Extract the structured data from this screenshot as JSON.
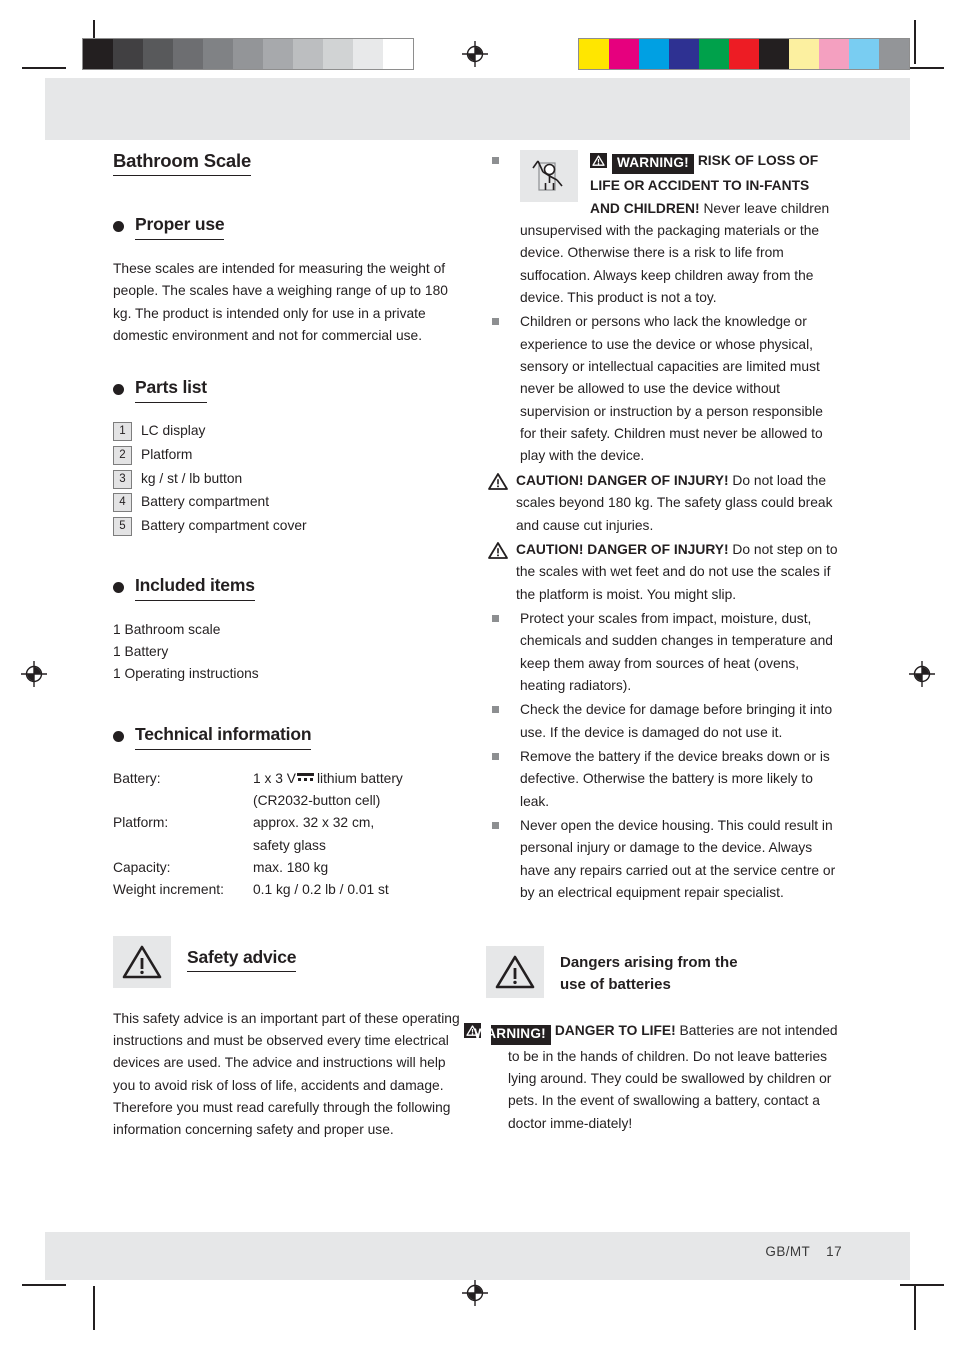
{
  "document": {
    "title": "Bathroom Scale",
    "footer": {
      "locale": "GB/MT",
      "page": "17"
    }
  },
  "left_column": {
    "sections": [
      {
        "id": "proper_use",
        "heading": "Proper use",
        "paragraph": "These scales are intended for measuring the weight of people. The scales have a weighing range of up to 180 kg. The product is intended only for use in a private domestic environment and not for commercial use."
      },
      {
        "id": "parts_list",
        "heading": "Parts list",
        "items": [
          {
            "num": "1",
            "label": "LC display"
          },
          {
            "num": "2",
            "label": "Platform"
          },
          {
            "num": "3",
            "label": "kg / st / lb button"
          },
          {
            "num": "4",
            "label": "Battery compartment"
          },
          {
            "num": "5",
            "label": "Battery compartment cover"
          }
        ]
      },
      {
        "id": "included_items",
        "heading": "Included items",
        "items": [
          "1 Bathroom scale",
          "1 Battery",
          "1 Operating instructions"
        ]
      },
      {
        "id": "technical_information",
        "heading": "Technical information",
        "rows": [
          {
            "key": "Battery:",
            "value_pre": "1 x 3 V",
            "value_post": "lithium battery",
            "has_dc_symbol": true,
            "value_cont": "(CR2032-button cell)"
          },
          {
            "key": "Platform:",
            "value": "approx. 32 x 32 cm,",
            "value_cont": "safety glass"
          },
          {
            "key": "Capacity:",
            "value": "max. 180 kg"
          },
          {
            "key": "Weight increment:",
            "value": "0.1 kg / 0.2 lb / 0.01 st"
          }
        ]
      },
      {
        "id": "safety_advice",
        "heading": "Safety advice",
        "icon": "warning-triangle-icon",
        "paragraph": "This safety advice is an important part of these operating instructions and must be observed every time electrical devices are used. The advice and instructions will help you to avoid risk of loss of life, accidents and damage. Therefore you must read carefully through the following information concerning safety and proper use."
      }
    ]
  },
  "right_column": {
    "warnings": [
      {
        "id": "risk_of_loss_of_life",
        "marker": "square-bullet",
        "pictogram": "child-suffocation-icon",
        "badge": "WARNING!",
        "bold_lead": "RISK OF LOSS OF LIFE OR ACCIDENT TO IN-FANTS AND CHILDREN!",
        "text": "Never leave children unsupervised with the packaging materials or the device. Otherwise there is a risk to life from suffocation. Always keep children away from the device. This product is not a toy."
      },
      {
        "id": "children_or_persons",
        "marker": "square-bullet",
        "text": "Children or persons who lack the knowledge or experience to use the device or whose physical, sensory or intellectual capacities are limited must never be allowed to use the device without supervision or instruction by a person responsible for their safety. Children must never be allowed to play with the device."
      },
      {
        "id": "caution_overload",
        "marker": "triangle-bullet",
        "bold_lead": "CAUTION! DANGER OF INJURY!",
        "text": "Do not load the scales beyond 180 kg. The safety glass could break and cause cut injuries."
      },
      {
        "id": "caution_wet_feet",
        "marker": "triangle-bullet",
        "bold_lead": "CAUTION! DANGER OF INJURY!",
        "text": "Do not step on to the scales with wet feet and do not use the scales if the platform is moist. You might slip."
      },
      {
        "id": "protect_scales",
        "marker": "square-bullet",
        "text": "Protect your scales from impact, moisture, dust, chemicals and sudden changes in temperature and keep them away from sources of heat (ovens, heating radiators)."
      },
      {
        "id": "check_device",
        "marker": "square-bullet",
        "text": "Check the device for damage before bringing it into use. If the device is damaged do not use it."
      },
      {
        "id": "remove_battery",
        "marker": "square-bullet",
        "text": "Remove the battery if the device breaks down or is defective. Otherwise the battery is more likely to leak."
      },
      {
        "id": "never_open_housing",
        "marker": "square-bullet",
        "text": "Never open the device housing. This could result in personal injury or damage to the device. Always have any repairs carried out at the service centre or by an electrical equipment repair specialist."
      }
    ],
    "battery_section": {
      "icon": "warning-triangle-icon",
      "heading_line1": "Dangers arising from the",
      "heading_line2": "use of batteries",
      "badge": "WARNING!",
      "bold_lead": "DANGER TO LIFE!",
      "text": "Batteries are not intended to be in the hands of children. Do not leave batteries lying around. They could be swallowed by children or pets. In the event of swallowing a battery, contact a doctor imme-diately!"
    }
  },
  "print_marks": {
    "grayscale_bar": [
      "#231f20",
      "#414042",
      "#58595b",
      "#6d6e71",
      "#808285",
      "#939598",
      "#a7a9ac",
      "#bcbec0",
      "#d1d3d4",
      "#e8e9ea",
      "#ffffff"
    ],
    "color_bar": [
      "#ffe600",
      "#e6007e",
      "#00a0e3",
      "#2e3192",
      "#00a14b",
      "#ed1c24",
      "#231f20",
      "#fcf0a0",
      "#f4a0c0",
      "#79cdf2",
      "#939598"
    ],
    "registration_mark": "registration-crosshair-icon"
  }
}
